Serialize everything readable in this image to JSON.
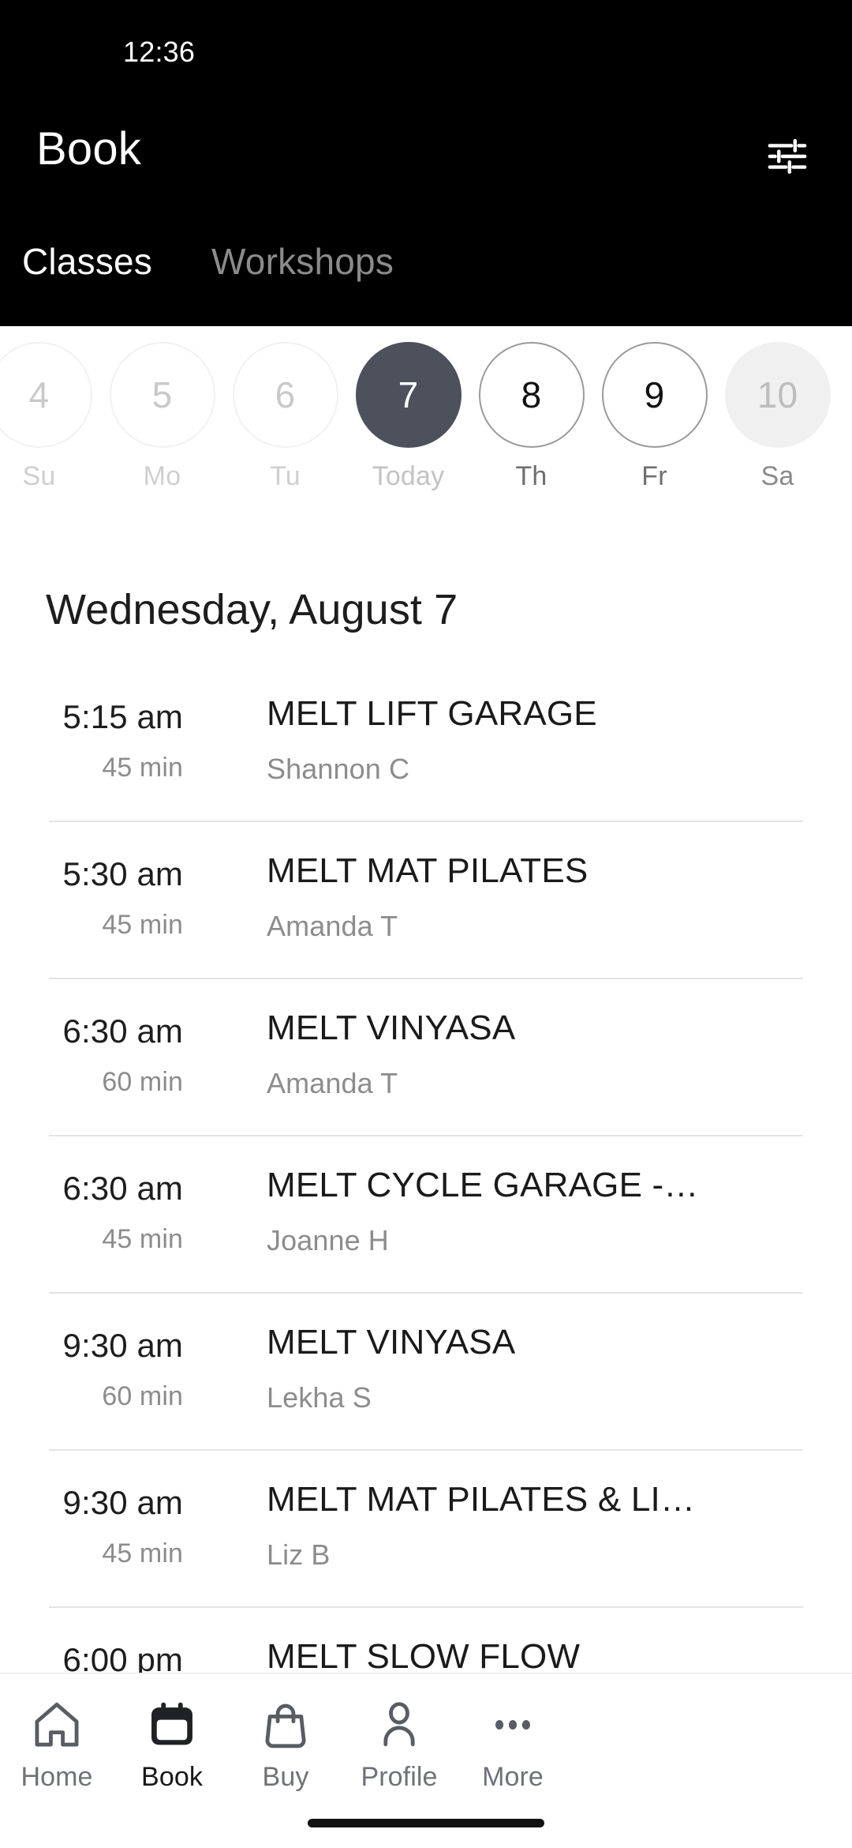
{
  "status_bar": {
    "time": "12:36"
  },
  "header": {
    "title": "Book",
    "filter_icon": "tune-sliders-icon",
    "tabs": [
      {
        "label": "Classes",
        "active": true
      },
      {
        "label": "Workshops",
        "active": false
      }
    ]
  },
  "date_strip": {
    "days": [
      {
        "num": "4",
        "label": "Su",
        "state": "past"
      },
      {
        "num": "5",
        "label": "Mo",
        "state": "past"
      },
      {
        "num": "6",
        "label": "Tu",
        "state": "past"
      },
      {
        "num": "7",
        "label": "Today",
        "state": "selected"
      },
      {
        "num": "8",
        "label": "Th",
        "state": "available"
      },
      {
        "num": "9",
        "label": "Fr",
        "state": "available"
      },
      {
        "num": "10",
        "label": "Sa",
        "state": "muted"
      }
    ]
  },
  "schedule": {
    "section_date": "Wednesday, August 7",
    "classes": [
      {
        "time": "5:15 am",
        "duration": "45 min",
        "name": "MELT LIFT GARAGE",
        "instructor": "Shannon C"
      },
      {
        "time": "5:30 am",
        "duration": "45 min",
        "name": "MELT MAT PILATES",
        "instructor": "Amanda T"
      },
      {
        "time": "6:30 am",
        "duration": "60 min",
        "name": "MELT VINYASA",
        "instructor": "Amanda T"
      },
      {
        "time": "6:30 am",
        "duration": "45 min",
        "name": "MELT CYCLE GARAGE -…",
        "instructor": "Joanne H"
      },
      {
        "time": "9:30 am",
        "duration": "60 min",
        "name": "MELT VINYASA",
        "instructor": "Lekha S"
      },
      {
        "time": "9:30 am",
        "duration": "45 min",
        "name": "MELT MAT PILATES & LI…",
        "instructor": "Liz B"
      },
      {
        "time": "6:00 pm",
        "duration": "",
        "name": "MELT SLOW FLOW",
        "instructor": ""
      }
    ]
  },
  "bottom_nav": {
    "items": [
      {
        "label": "Home",
        "icon": "home-icon",
        "active": false
      },
      {
        "label": "Book",
        "icon": "calendar-icon",
        "active": true
      },
      {
        "label": "Buy",
        "icon": "bag-icon",
        "active": false
      },
      {
        "label": "Profile",
        "icon": "person-icon",
        "active": false
      },
      {
        "label": "More",
        "icon": "dots-icon",
        "active": false
      }
    ]
  },
  "colors": {
    "header_bg": "#000000",
    "selected_day_bg": "#4c515c",
    "muted_day_bg": "#f0f0f0",
    "nav_inactive": "#6e7278",
    "nav_active": "#17181a"
  }
}
